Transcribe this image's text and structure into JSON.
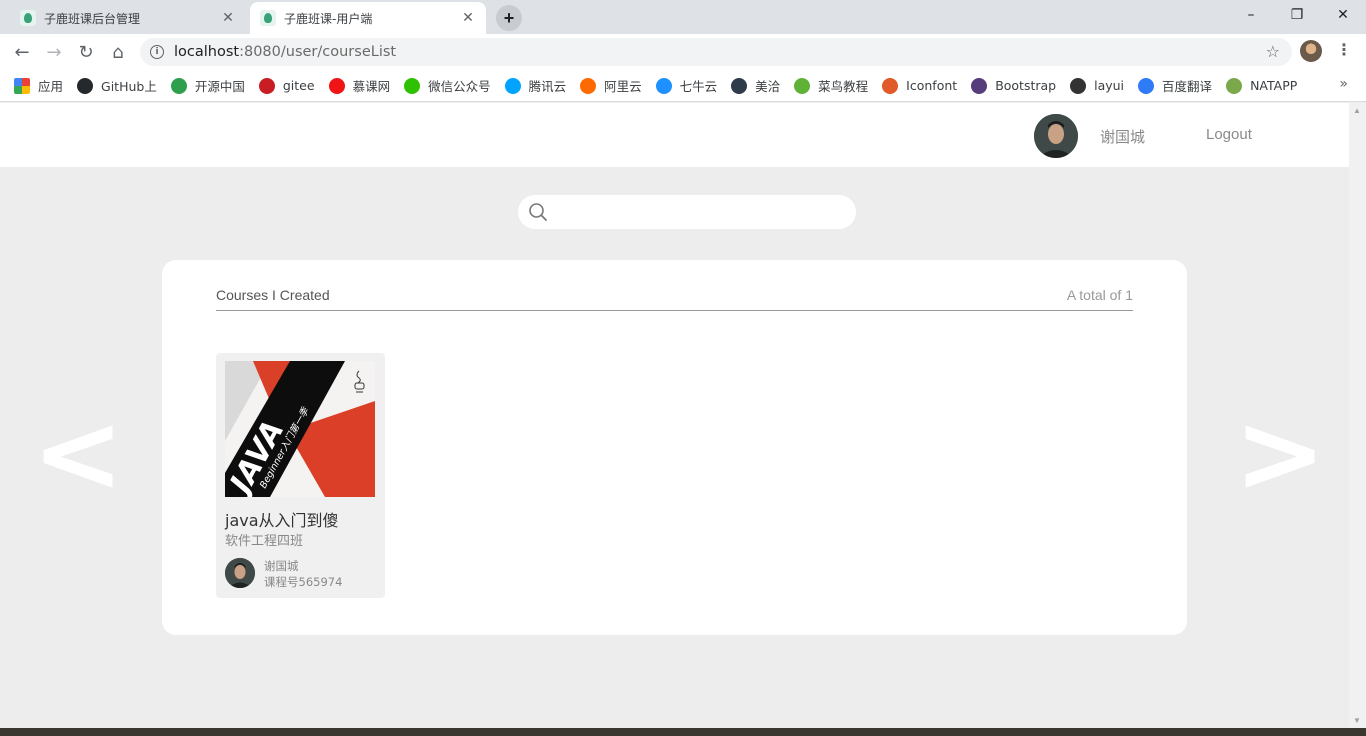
{
  "browser": {
    "tabs": [
      {
        "title": "子鹿班课后台管理",
        "active": false
      },
      {
        "title": "子鹿班课-用户端",
        "active": true
      }
    ],
    "url_host": "localhost",
    "url_rest": ":8080/user/courseList",
    "bookmarks": [
      {
        "label": "应用",
        "icon": "apps-grid-icon",
        "color": "#ea4335"
      },
      {
        "label": "GitHub上",
        "icon": "github-icon",
        "color": "#24292e"
      },
      {
        "label": "开源中国",
        "icon": "oschina-icon",
        "color": "#2e9f4d"
      },
      {
        "label": "gitee",
        "icon": "gitee-icon",
        "color": "#c71d23"
      },
      {
        "label": "慕课网",
        "icon": "imooc-flame-icon",
        "color": "#f01414"
      },
      {
        "label": "微信公众号",
        "icon": "wechat-icon",
        "color": "#2dc100"
      },
      {
        "label": "腾讯云",
        "icon": "tencent-cloud-icon",
        "color": "#00a4ff"
      },
      {
        "label": "阿里云",
        "icon": "aliyun-icon",
        "color": "#ff6a00"
      },
      {
        "label": "七牛云",
        "icon": "qiniu-icon",
        "color": "#1e90ff"
      },
      {
        "label": "美洽",
        "icon": "meiqia-icon",
        "color": "#2f3a4a"
      },
      {
        "label": "菜鸟教程",
        "icon": "runoob-icon",
        "color": "#5fb236"
      },
      {
        "label": "Iconfont",
        "icon": "iconfont-icon",
        "color": "#e05a2a"
      },
      {
        "label": "Bootstrap",
        "icon": "bootstrap-icon",
        "color": "#563d7c"
      },
      {
        "label": "layui",
        "icon": "layui-icon",
        "color": "#333333"
      },
      {
        "label": "百度翻译",
        "icon": "baidu-translate-icon",
        "color": "#2f7bf5"
      },
      {
        "label": "NATAPP",
        "icon": "natapp-icon",
        "color": "#7aa84a"
      }
    ]
  },
  "header": {
    "username": "谢国城",
    "logout_label": "Logout"
  },
  "search": {
    "value": "",
    "placeholder": ""
  },
  "panel": {
    "title": "Courses I Created",
    "total": "A total of 1"
  },
  "courses": [
    {
      "name": "java从入门到傻",
      "class_name": "软件工程四班",
      "teacher": "谢国城",
      "code": "课程号565974",
      "cover_text": "JAVA",
      "cover_subtitle": "Beginner入门第一季"
    }
  ],
  "nav": {
    "prev": "<",
    "next": ">"
  }
}
